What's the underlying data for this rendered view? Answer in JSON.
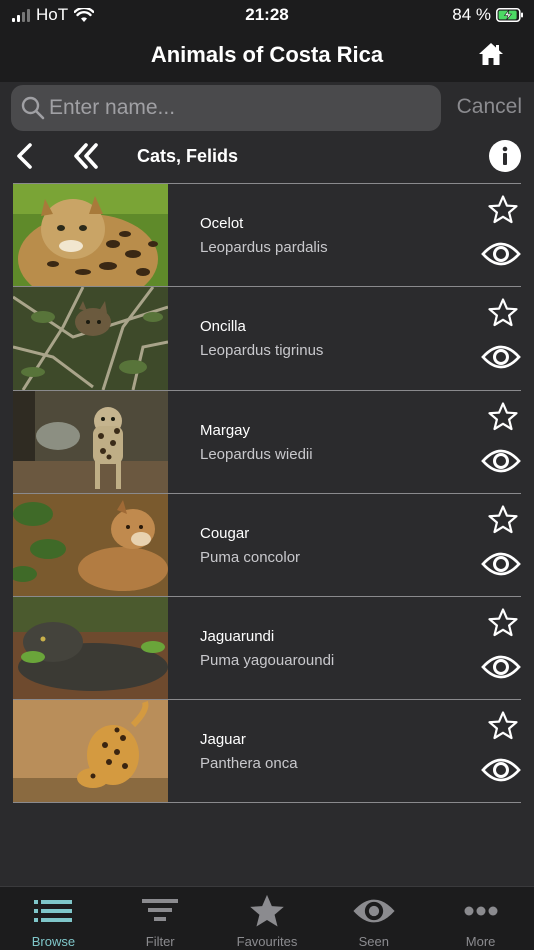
{
  "status_bar": {
    "carrier": "HoT",
    "time": "21:28",
    "battery_percent": "84 %"
  },
  "nav": {
    "title": "Animals of Costa Rica"
  },
  "search": {
    "placeholder": "Enter name...",
    "value": "",
    "cancel_label": "Cancel"
  },
  "breadcrumb": {
    "title": "Cats, Felids"
  },
  "animals": [
    {
      "common": "Ocelot",
      "latin": "Leopardus pardalis"
    },
    {
      "common": "Oncilla",
      "latin": "Leopardus tigrinus"
    },
    {
      "common": "Margay",
      "latin": "Leopardus wiedii"
    },
    {
      "common": "Cougar",
      "latin": "Puma concolor"
    },
    {
      "common": "Jaguarundi",
      "latin": "Puma yagouaroundi"
    },
    {
      "common": "Jaguar",
      "latin": "Panthera onca"
    }
  ],
  "tabs": [
    {
      "label": "Browse",
      "icon": "list-icon",
      "active": true
    },
    {
      "label": "Filter",
      "icon": "filter-icon",
      "active": false
    },
    {
      "label": "Favourites",
      "icon": "star-icon",
      "active": false
    },
    {
      "label": "Seen",
      "icon": "eye-icon",
      "active": false
    },
    {
      "label": "More",
      "icon": "more-icon",
      "active": false
    }
  ],
  "colors": {
    "accent": "#7fc6c9",
    "background": "#2b2b2d",
    "bar": "#1c1c1d",
    "battery_fill": "#4cd964"
  }
}
